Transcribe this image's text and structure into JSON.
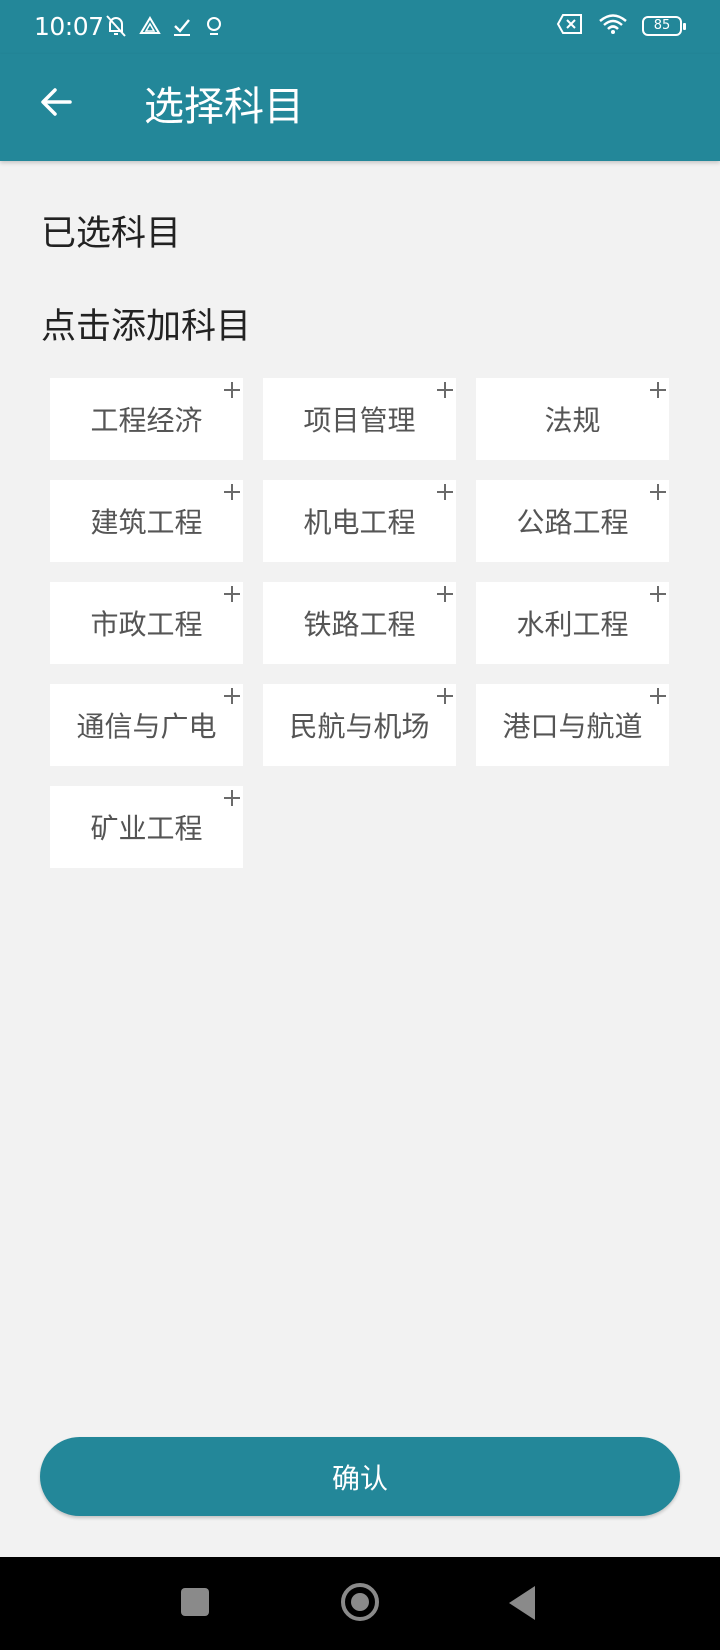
{
  "status_bar": {
    "time": "10:07",
    "battery": "85",
    "icons_left": [
      "notifications-off-icon",
      "drive-icon",
      "check-icon",
      "location-icon"
    ],
    "icons_right": [
      "sim-error-icon",
      "wifi-icon",
      "battery-icon"
    ]
  },
  "app_bar": {
    "back_icon": "arrow-left-icon",
    "title": "选择科目"
  },
  "selected_section": {
    "title": "已选科目"
  },
  "add_section": {
    "title": "点击添加科目",
    "subjects": [
      {
        "label": "工程经济"
      },
      {
        "label": "项目管理"
      },
      {
        "label": "法规"
      },
      {
        "label": "建筑工程"
      },
      {
        "label": "机电工程"
      },
      {
        "label": "公路工程"
      },
      {
        "label": "市政工程"
      },
      {
        "label": "铁路工程"
      },
      {
        "label": "水利工程"
      },
      {
        "label": "通信与广电"
      },
      {
        "label": "民航与机场"
      },
      {
        "label": "港口与航道"
      },
      {
        "label": "矿业工程"
      }
    ]
  },
  "confirm": {
    "label": "确认"
  },
  "colors": {
    "primary": "#238799",
    "background": "#f2f2f2",
    "card": "#ffffff"
  }
}
